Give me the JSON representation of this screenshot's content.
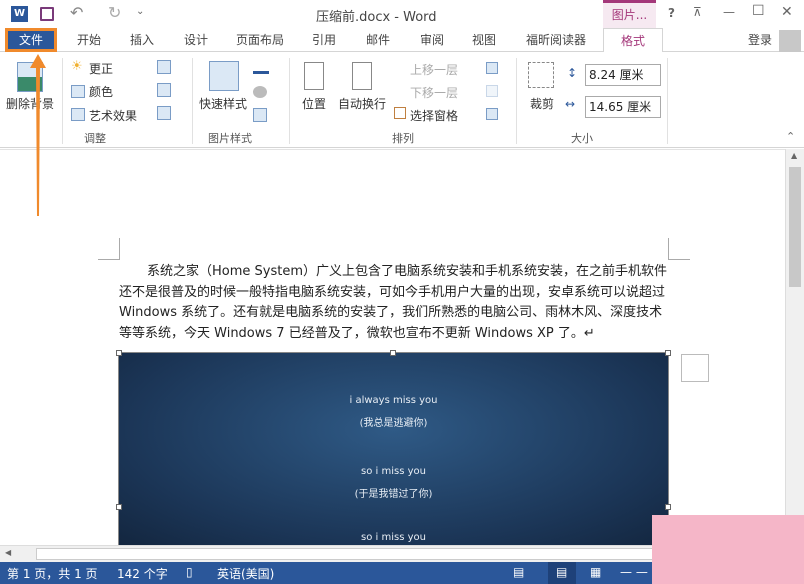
{
  "titlebar": {
    "title": "压缩前.docx - Word",
    "context_tab": "图片...",
    "help": "?",
    "ribbon_display": "⊼",
    "minimize": "—",
    "maximize": "☐",
    "close": "✕",
    "qat_undo": "↶",
    "qat_redo": "↻",
    "qat_more": "⌄"
  },
  "tabs": {
    "file": "文件",
    "items": [
      "开始",
      "插入",
      "设计",
      "页面布局",
      "引用",
      "邮件",
      "审阅",
      "视图",
      "福昕阅读器",
      "格式"
    ],
    "active": "格式",
    "signin": "登录"
  },
  "ribbon": {
    "adjust": {
      "label": "调整",
      "remove_bg": "删除背景",
      "corrections": "更正",
      "color": "颜色",
      "artistic": "艺术效果"
    },
    "styles": {
      "label": "图片样式",
      "quick_styles": "快速样式"
    },
    "arrange": {
      "label": "排列",
      "position": "位置",
      "wrap": "自动换行",
      "bring_forward": "上移一层",
      "send_backward": "下移一层",
      "selection_pane": "选择窗格"
    },
    "size": {
      "label": "大小",
      "crop": "裁剪",
      "height": "8.24 厘米",
      "width": "14.65 厘米"
    }
  },
  "document": {
    "paragraph": "系统之家（Home System）广义上包含了电脑系统安装和手机系统安装，在之前手机软件还不是很普及的时候一般特指电脑系统安装，可如今手机用户大量的出现，安卓系统可以说超过 Windows 系统了。还有就是电脑系统的安装了，我们所熟悉的电脑公司、雨林木风、深度技术等等系统，今天 Windows 7 已经普及了，微软也宣布不更新 Windows XP 了。↵",
    "image_lines": [
      "i always miss you",
      "(我总是逃避你)",
      "so i miss you",
      "(于是我错过了你)",
      "so i miss you"
    ]
  },
  "status": {
    "page": "第 1 页，共 1 页",
    "words": "142 个字",
    "language": "英语(美国)"
  },
  "colors": {
    "brand": "#2b579a",
    "context_accent": "#a4377a",
    "highlight": "#f08a2c"
  }
}
